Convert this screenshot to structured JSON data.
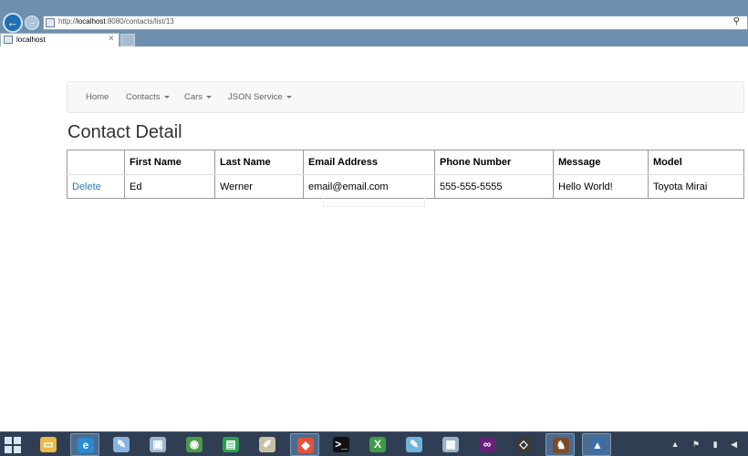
{
  "browser": {
    "url_prefix": "http://",
    "url_host": "localhost",
    "url_rest": ":8080/contacts/list/13",
    "tab_title": "localhost",
    "tab_close": "×",
    "back_icon": "←",
    "forward_icon": "→",
    "search_icon": "⚲"
  },
  "navbar": {
    "items": [
      {
        "label": "Home",
        "dropdown": false
      },
      {
        "label": "Contacts",
        "dropdown": true
      },
      {
        "label": "Cars",
        "dropdown": true
      },
      {
        "label": "JSON Service",
        "dropdown": true
      }
    ]
  },
  "page": {
    "title": "Contact Detail"
  },
  "table": {
    "headers": [
      "",
      "First Name",
      "Last Name",
      "Email Address",
      "Phone Number",
      "Message",
      "Model"
    ],
    "row": {
      "action": "Delete",
      "first_name": "Ed",
      "last_name": "Werner",
      "email": "email@email.com",
      "phone": "555-555-5555",
      "message": "Hello World!",
      "model": "Toyota Mirai"
    }
  },
  "taskbar": {
    "apps": [
      {
        "name": "file-explorer-icon",
        "color": "#e9b949",
        "glyph": "▭"
      },
      {
        "name": "internet-explorer-icon",
        "color": "#2a8ad4",
        "glyph": "e",
        "active": true
      },
      {
        "name": "paint-icon",
        "color": "#8ab4e0",
        "glyph": "✎"
      },
      {
        "name": "remote-desktop-icon",
        "color": "#9fb7cf",
        "glyph": "▣"
      },
      {
        "name": "chrome-icon",
        "color": "#4a9a4a",
        "glyph": "◉"
      },
      {
        "name": "store-icon",
        "color": "#2e9e4f",
        "glyph": "▤"
      },
      {
        "name": "notepad-icon",
        "color": "#c9c1a6",
        "glyph": "✐"
      },
      {
        "name": "git-icon",
        "color": "#e0533a",
        "glyph": "◆",
        "active": true
      },
      {
        "name": "command-prompt-icon",
        "color": "#111111",
        "glyph": ">_"
      },
      {
        "name": "excel-icon",
        "color": "#3f9b45",
        "glyph": "X"
      },
      {
        "name": "notepad-plus-icon",
        "color": "#6fb3d9",
        "glyph": "✎"
      },
      {
        "name": "calculator-icon",
        "color": "#9db1c8",
        "glyph": "▦"
      },
      {
        "name": "visual-studio-icon",
        "color": "#68217a",
        "glyph": "∞"
      },
      {
        "name": "unity-icon",
        "color": "#3a3a3a",
        "glyph": "◇"
      },
      {
        "name": "game-icon",
        "color": "#7a4d2a",
        "glyph": "♞",
        "active": true
      },
      {
        "name": "sql-server-icon",
        "color": "#3b6ea5",
        "glyph": "▲",
        "active": true
      }
    ],
    "tray": "▲ ⚑ ▮ ◀"
  }
}
